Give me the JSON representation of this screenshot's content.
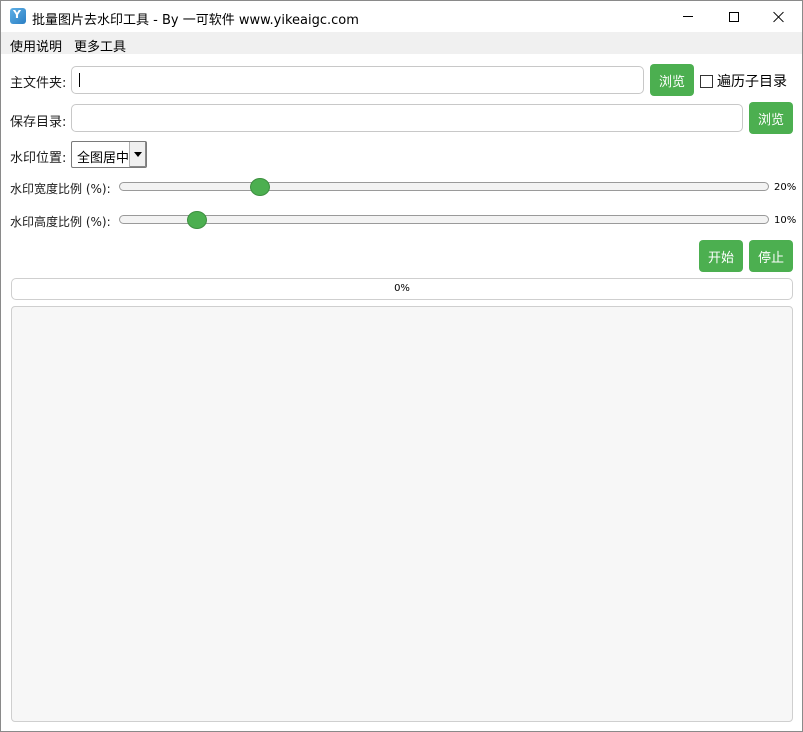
{
  "window": {
    "title": "批量图片去水印工具 - By 一可软件 www.yikeaigc.com"
  },
  "menu": {
    "items": [
      "使用说明",
      "更多工具"
    ]
  },
  "form": {
    "source_folder": {
      "label": "主文件夹:",
      "value": "",
      "browse_label": "浏览"
    },
    "recursive": {
      "label": "遍历子目录",
      "checked": false
    },
    "save_dir": {
      "label": "保存目录:",
      "value": "",
      "browse_label": "浏览"
    },
    "position": {
      "label": "水印位置:",
      "selected": "全图居中"
    },
    "width_ratio": {
      "label": "水印宽度比例 (%):",
      "value": 20,
      "value_text": "20%"
    },
    "height_ratio": {
      "label": "水印高度比例 (%):",
      "value": 10,
      "value_text": "10%"
    }
  },
  "actions": {
    "start_label": "开始",
    "stop_label": "停止"
  },
  "progress": {
    "value": 0,
    "text": "0%"
  },
  "colors": {
    "accent": "#4caf50"
  }
}
